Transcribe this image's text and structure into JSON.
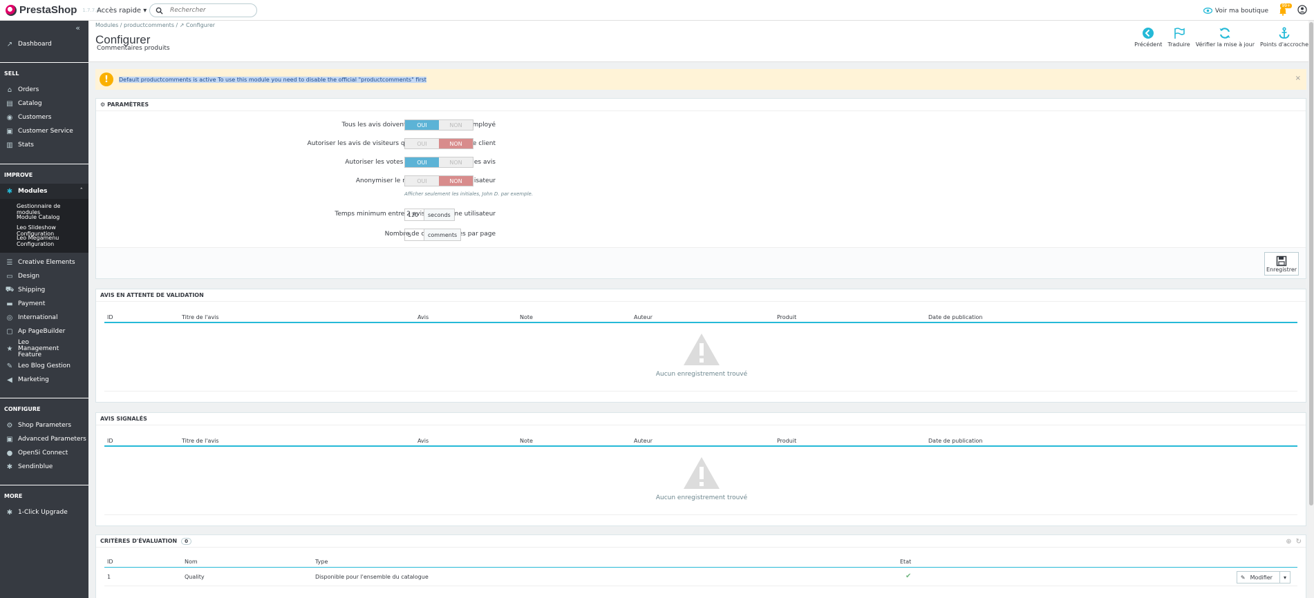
{
  "header": {
    "brand": "PrestaShop",
    "version": "1.7.7.4",
    "quick_access": "Accès rapide",
    "search_placeholder": "Rechercher",
    "view_shop": "Voir ma boutique",
    "notif_count": "99+"
  },
  "sidebar": {
    "dashboard": "Dashboard",
    "sections": {
      "sell": "SELL",
      "improve": "IMPROVE",
      "configure": "CONFIGURE",
      "more": "MORE"
    },
    "sell_items": [
      "Orders",
      "Catalog",
      "Customers",
      "Customer Service",
      "Stats"
    ],
    "modules": "Modules",
    "module_sub": [
      "Gestionnaire de modules",
      "Module Catalog",
      "Leo Slideshow Configuration",
      "Leo Megamenu Configuration"
    ],
    "improve_items": [
      "Creative Elements",
      "Design",
      "Shipping",
      "Payment",
      "International",
      "Ap PageBuilder",
      "Leo Management Feature",
      "Leo Blog Gestion",
      "Marketing"
    ],
    "configure_items": [
      "Shop Parameters",
      "Advanced Parameters",
      "OpenSi Connect",
      "Sendinblue"
    ],
    "more_items": [
      "1-Click Upgrade"
    ]
  },
  "page": {
    "breadcrumb": "Modules  /  productcomments  /  ↗ Configurer",
    "title": "Configurer",
    "subtitle": "Commentaires produits",
    "toolbar": [
      "Précédent",
      "Traduire",
      "Vérifier la mise à jour",
      "Points d'accroche"
    ]
  },
  "alert": {
    "text": "Default productcomments is active To use this module you need to disable the official \"productcomments\" first"
  },
  "settings": {
    "title": "PARAMÈTRES",
    "yes": "OUI",
    "no": "NON",
    "rows": [
      {
        "label": "Tous les avis doivent être validés par un employé",
        "value": "OUI"
      },
      {
        "label": "Autoriser les avis de visiteurs qui n'ont pas de compte client",
        "value": "NON"
      },
      {
        "label": "Autoriser les votes positifs / négatifs sur les avis",
        "value": "OUI"
      },
      {
        "label": "Anonymiser le nom de famille de l'utilisateur",
        "value": "NON"
      }
    ],
    "help": "Afficher seulement les initiales, John D. par exemple.",
    "min_time_label": "Temps minimum entre 2 avis d'un même utilisateur",
    "min_time_value": "120",
    "min_time_unit": "seconds",
    "per_page_label": "Nombre de commentaires par page",
    "per_page_value": "5",
    "per_page_unit": "comments",
    "save": "Enregistrer"
  },
  "pending": {
    "title": "AVIS EN ATTENTE DE VALIDATION",
    "columns": [
      "ID",
      "Titre de l'avis",
      "Avis",
      "Note",
      "Auteur",
      "Produit",
      "Date de publication"
    ],
    "empty": "Aucun enregistrement trouvé"
  },
  "reported": {
    "title": "AVIS SIGNALÉS",
    "columns": [
      "ID",
      "Titre de l'avis",
      "Avis",
      "Note",
      "Auteur",
      "Produit",
      "Date de publication"
    ],
    "empty": "Aucun enregistrement trouvé"
  },
  "criteria": {
    "title": "CRITÈRES D'ÉVALUATION",
    "count": "0",
    "columns": [
      "ID",
      "Nom",
      "Type",
      "Etat"
    ],
    "rows": [
      {
        "id": "1",
        "name": "Quality",
        "type": "Disponible pour l'ensemble du catalogue",
        "state": "✔"
      }
    ],
    "edit": "Modifier"
  },
  "colors": {
    "accent": "#25b9d7",
    "on": "#5cb3d6",
    "off": "#d88c8c",
    "warning": "#fab000",
    "sidebar": "#363a41",
    "brand": "#df0067"
  }
}
